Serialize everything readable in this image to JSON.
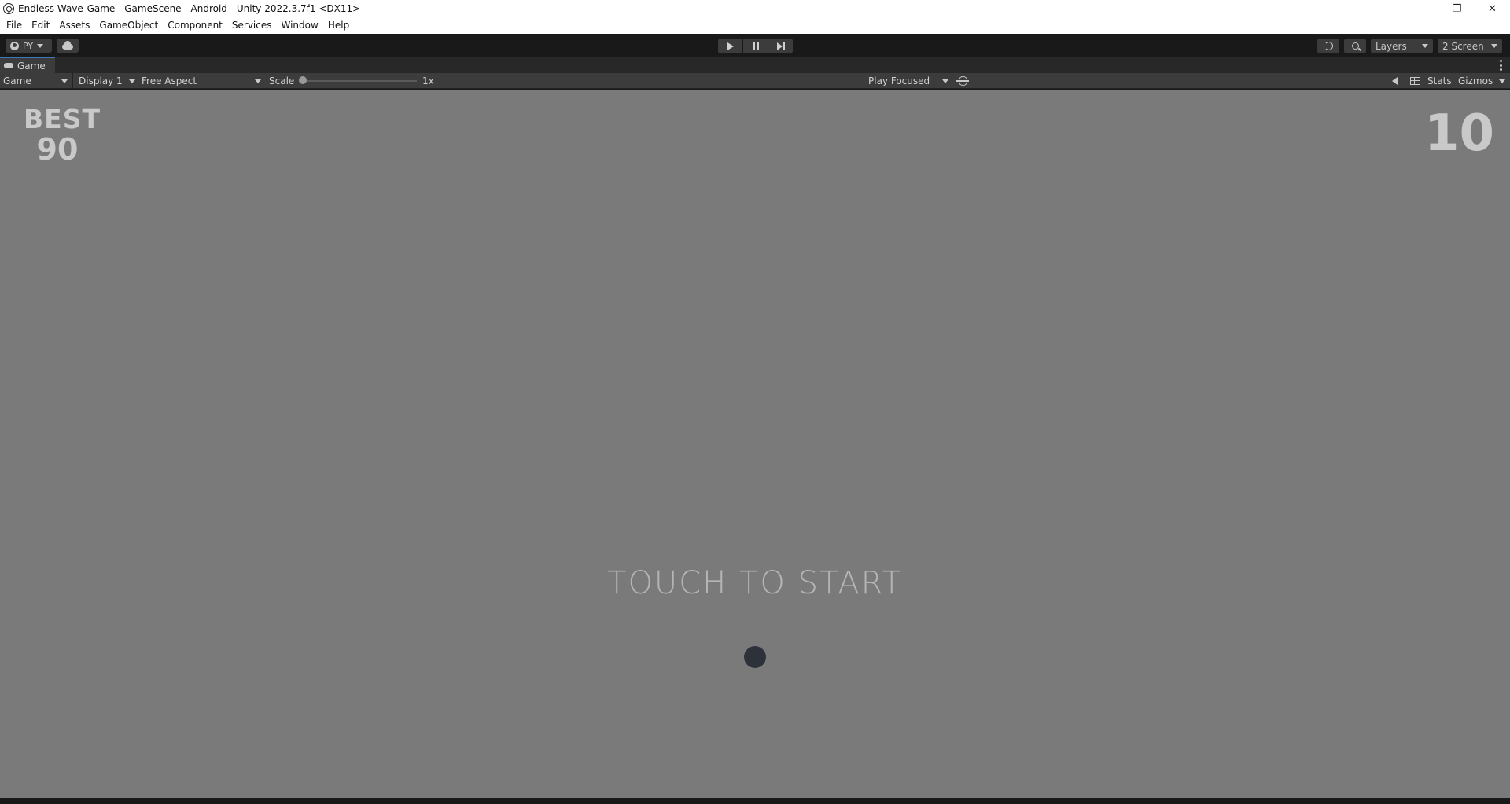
{
  "window": {
    "title": "Endless-Wave-Game - GameScene - Android - Unity 2022.3.7f1 <DX11>",
    "minimize": "—",
    "restore": "❐",
    "close": "✕"
  },
  "menu": [
    "File",
    "Edit",
    "Assets",
    "GameObject",
    "Component",
    "Services",
    "Window",
    "Help"
  ],
  "toolbar": {
    "account_label": "PY",
    "layers_label": "Layers",
    "layout_label": "2 Screen"
  },
  "tab": {
    "label": "Game"
  },
  "game_bar": {
    "mode": "Game",
    "display": "Display 1",
    "aspect": "Free Aspect",
    "scale_label": "Scale",
    "scale_value": "1x",
    "play_mode": "Play Focused",
    "stats": "Stats",
    "gizmos": "Gizmos"
  },
  "game": {
    "best_label": "BEST",
    "best_value": "90",
    "score": "10",
    "prompt": "TOUCH TO START"
  },
  "colors": {
    "viewport_bg": "#7a7a7a",
    "ball": "#2d313a",
    "hud_text": "#c9c9c9"
  }
}
